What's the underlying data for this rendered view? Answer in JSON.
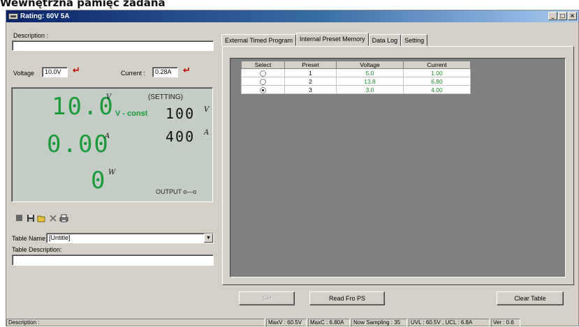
{
  "page_heading": "Wewnętrzna pamięć zadana",
  "window": {
    "title": "Rating: 60V 5A",
    "buttons": [
      "_",
      "□",
      "×"
    ]
  },
  "left": {
    "description_label": "Description :",
    "description_value": "",
    "voltage_label": "Voltage",
    "voltage_value": "10.0V",
    "current_label": "Current :",
    "current_value": "0.28A",
    "arrow_glyph": "↵"
  },
  "lcd": {
    "voltage_reading": "10.0",
    "voltage_unit": "V",
    "current_reading": "0.00",
    "current_unit": "A",
    "power_reading": "0",
    "power_unit": "W",
    "setting_label": "(SETTING)",
    "mode_label": "V - const",
    "set_voltage": "100",
    "set_voltage_unit": "V",
    "set_current": "400",
    "set_current_unit": "A",
    "output_label": "OUTPUT o—o"
  },
  "toolbar_icons": [
    "new-icon",
    "save-icon",
    "open-icon",
    "delete-icon",
    "print-icon"
  ],
  "table_name": {
    "label": "Table Name:",
    "value": "[Untitle]"
  },
  "table_description": {
    "label": "Table Description:",
    "value": ""
  },
  "tabs": [
    {
      "label": "External Timed Program",
      "active": false
    },
    {
      "label": "Internal Preset Memory",
      "active": true
    },
    {
      "label": "Data Log",
      "active": false
    },
    {
      "label": "Setting",
      "active": false
    }
  ],
  "grid": {
    "columns": [
      "Select",
      "Preset",
      "Voltage",
      "Current"
    ],
    "rows": [
      {
        "selected": false,
        "preset": "1",
        "voltage": "5.0",
        "current": "1.00"
      },
      {
        "selected": false,
        "preset": "2",
        "voltage": "13.8",
        "current": "6.80"
      },
      {
        "selected": true,
        "preset": "3",
        "voltage": "3.0",
        "current": "4.00"
      }
    ]
  },
  "buttons": {
    "set": "Set",
    "read": "Read Fro PS",
    "clear": "Clear Table"
  },
  "status": {
    "description": "Description :",
    "maxv": "MaxV : 60.5V",
    "maxc": "MaxC : 6.80A",
    "sampling": "Now Sampling : 35",
    "limits": "UVL : 60.5V , UCL : 6.8A",
    "ver": "Ver : 0.6"
  },
  "colors": {
    "lcd_background": "#c4ccc6",
    "lcd_green": "#1a9a3a",
    "arrow_red": "#c00000",
    "grid_value_green": "#1a8a2a",
    "titlebar": "#0a246a"
  }
}
